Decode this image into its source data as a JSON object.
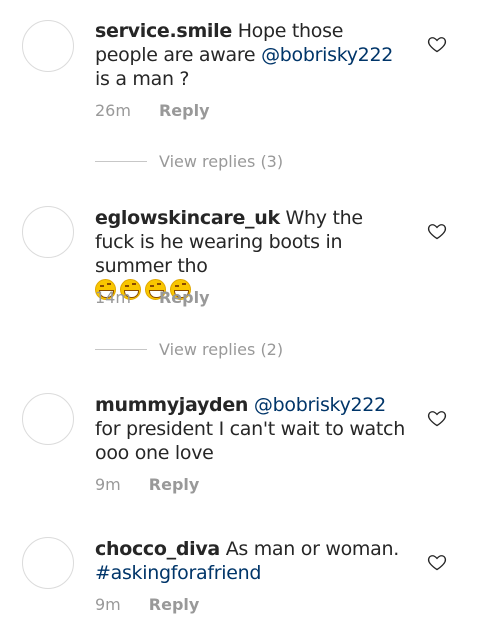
{
  "comments": [
    {
      "username": "service.smile",
      "text_before": " Hope those people are aware ",
      "mention": "@bobrisky222",
      "text_after": " is a man ?",
      "time": "26m",
      "reply_label": "Reply",
      "view_replies": "View replies (3)"
    },
    {
      "username": "eglowskincare_uk",
      "text": " Why the fuck is he wearing boots in summer tho",
      "emojis": [
        "grinning-squint-emoji",
        "grinning-squint-emoji",
        "grinning-squint-emoji",
        "grinning-squint-emoji"
      ],
      "time": "14m",
      "reply_label": "Reply",
      "view_replies": "View replies (2)"
    },
    {
      "username": "mummyjayden",
      "mention": "@bobrisky222",
      "text_after": " for president I can't wait to watch ooo one love",
      "time": "9m",
      "reply_label": "Reply"
    },
    {
      "username": "chocco_diva",
      "text": " As man or woman. ",
      "hashtag": "#askingforafriend",
      "time": "9m",
      "reply_label": "Reply"
    }
  ],
  "icons": {
    "like": "heart-outline-icon",
    "avatar": "empty-avatar"
  },
  "colors": {
    "text": "#262626",
    "link": "#003569",
    "muted": "#999999"
  }
}
